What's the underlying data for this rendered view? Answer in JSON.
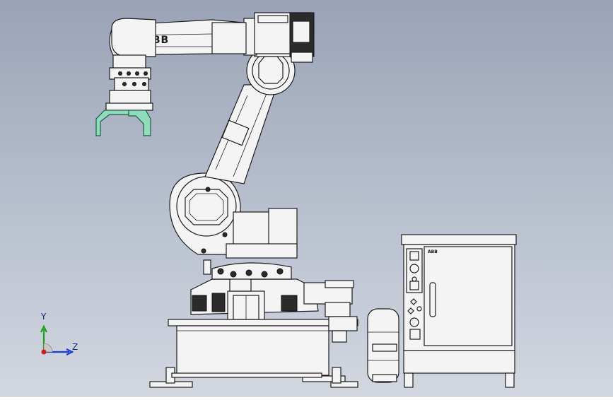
{
  "scene": {
    "background_top": "#9aa3b6",
    "background_bottom": "#d2d7e0",
    "robot_brand": "ABB",
    "controller_brand": "ABB",
    "gripper_color": "#7fd3b0"
  },
  "triad": {
    "y_label": "Y",
    "z_label": "Z",
    "y_color": "#1aa31a",
    "z_color": "#1a3fcf",
    "origin_color": "#d11a1a"
  }
}
